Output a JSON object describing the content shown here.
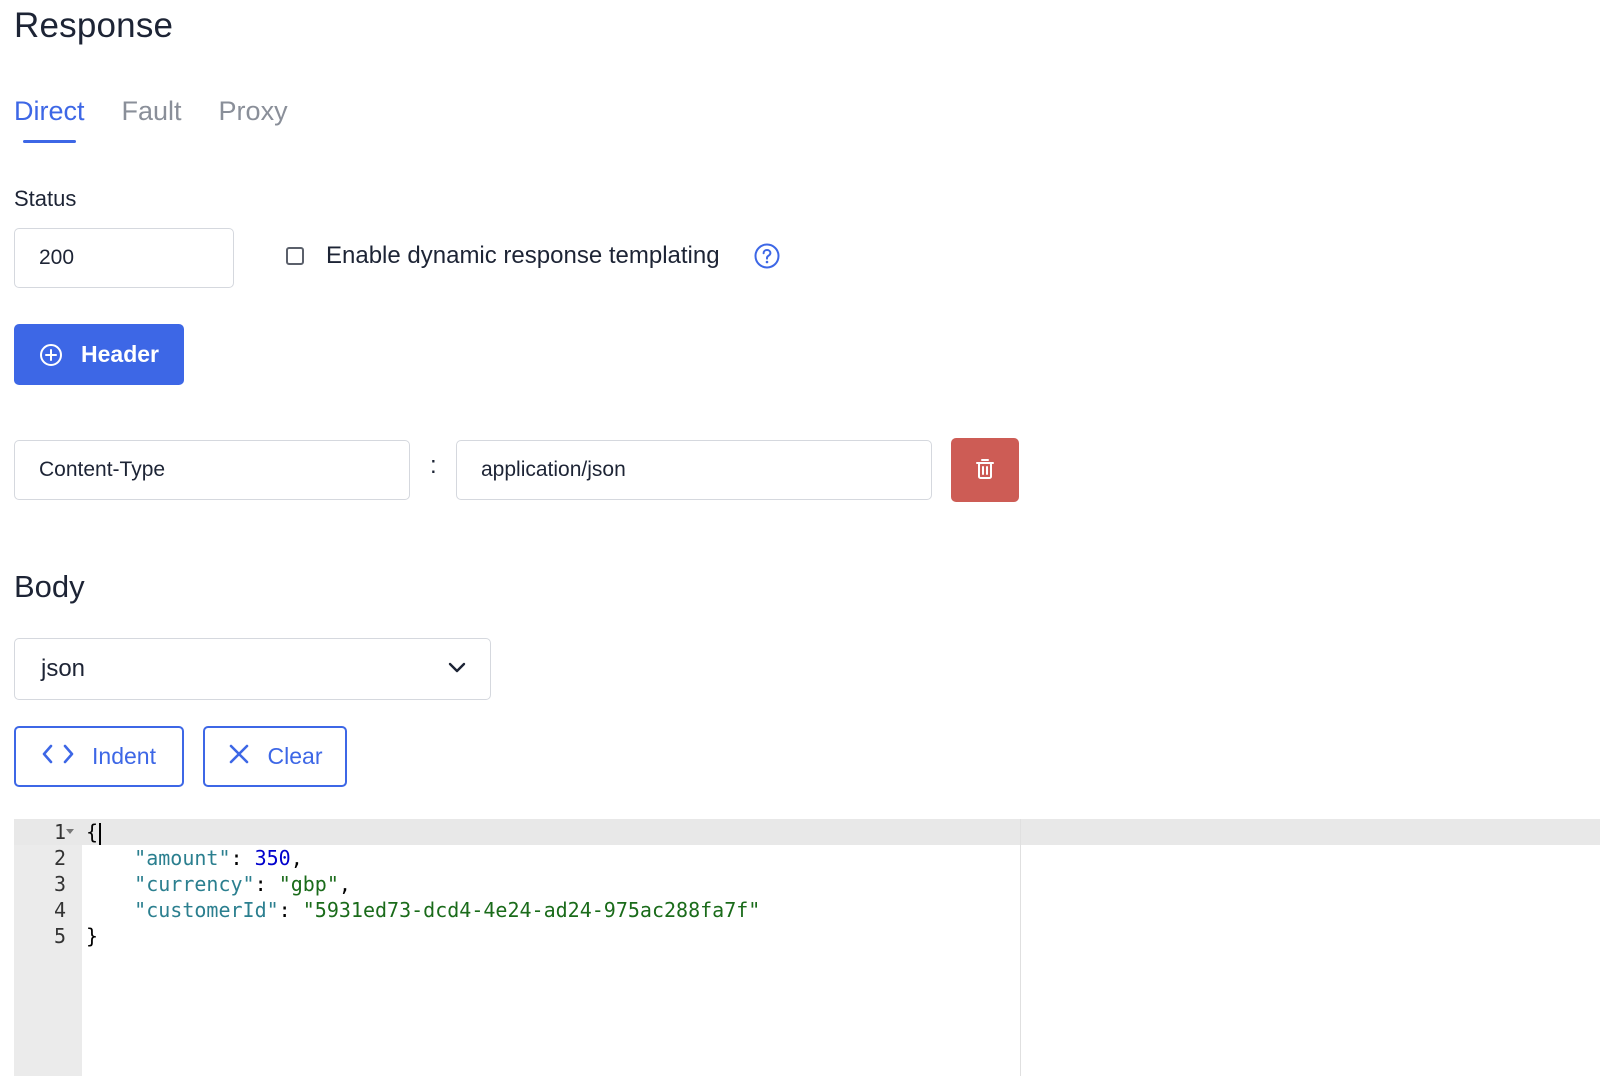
{
  "page": {
    "title": "Response"
  },
  "tabs": [
    {
      "label": "Direct",
      "active": true
    },
    {
      "label": "Fault",
      "active": false
    },
    {
      "label": "Proxy",
      "active": false
    }
  ],
  "status": {
    "label": "Status",
    "value": "200"
  },
  "templating": {
    "label": "Enable dynamic response templating",
    "checked": false,
    "help_icon": "question-circle-icon"
  },
  "header_button": {
    "label": "Header",
    "icon": "plus-circle-icon"
  },
  "headers": [
    {
      "key": "Content-Type",
      "separator": ":",
      "value": "application/json",
      "delete_icon": "trash-icon"
    }
  ],
  "body": {
    "title": "Body",
    "format_selected": "json",
    "indent_label": "Indent",
    "indent_icon": "code-icon",
    "clear_label": "Clear",
    "clear_icon": "close-icon"
  },
  "editor": {
    "line_numbers": [
      "1",
      "2",
      "3",
      "4",
      "5"
    ],
    "lines": {
      "l1_brace": "{",
      "l2_key": "\"amount\"",
      "l2_colon": ": ",
      "l2_value": "350",
      "l2_comma": ",",
      "l3_key": "\"currency\"",
      "l3_colon": ": ",
      "l3_value": "\"gbp\"",
      "l3_comma": ",",
      "l4_key": "\"customerId\"",
      "l4_colon": ": ",
      "l4_value": "\"5931ed73-dcd4-4e24-ad24-975ac288fa7f\"",
      "l5_brace": "}"
    }
  },
  "colors": {
    "accent": "#3d67e6",
    "danger": "#cd5c55",
    "json_key": "#2b7f8f",
    "json_number": "#0000cd",
    "json_string": "#1a6b1a"
  }
}
